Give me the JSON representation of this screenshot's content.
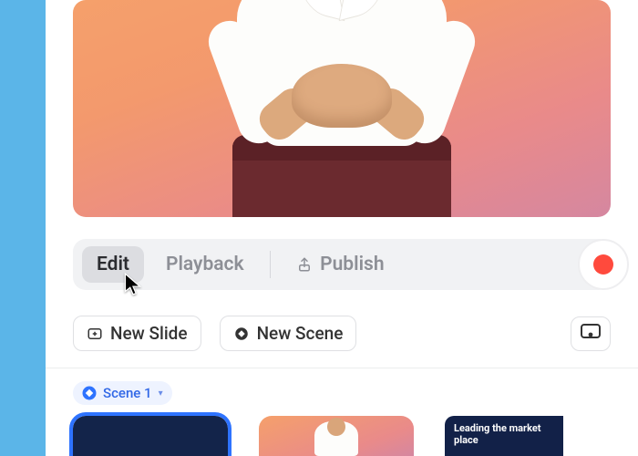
{
  "toolbar": {
    "edit_label": "Edit",
    "playback_label": "Playback",
    "publish_label": "Publish"
  },
  "actions": {
    "new_slide_label": "New Slide",
    "new_scene_label": "New Scene"
  },
  "scene": {
    "label": "Scene 1"
  },
  "slides": {
    "slide3_text": "Leading the market place"
  }
}
